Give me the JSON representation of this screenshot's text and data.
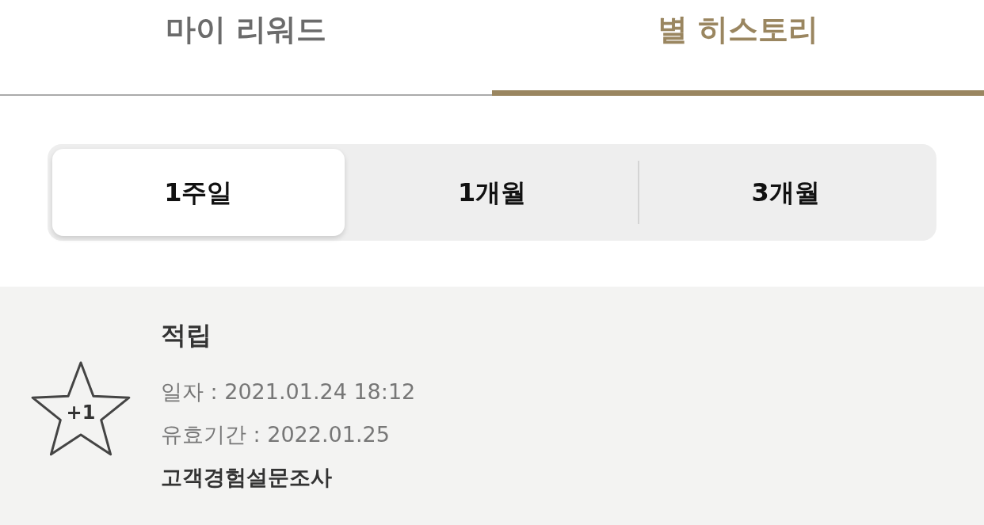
{
  "tabs": [
    {
      "label": "마이 리워드",
      "selected": false
    },
    {
      "label": "별 히스토리",
      "selected": true
    }
  ],
  "period_filter": [
    {
      "label": "1주일",
      "selected": true
    },
    {
      "label": "1개월",
      "selected": false
    },
    {
      "label": "3개월",
      "selected": false
    }
  ],
  "history": [
    {
      "kind": "earn",
      "badge": "+1",
      "title": "적립",
      "date": "일자 : 2021.01.24 18:12",
      "expiry": "유효기간 : 2022.01.25",
      "source": "고객경험설문조사"
    }
  ]
}
